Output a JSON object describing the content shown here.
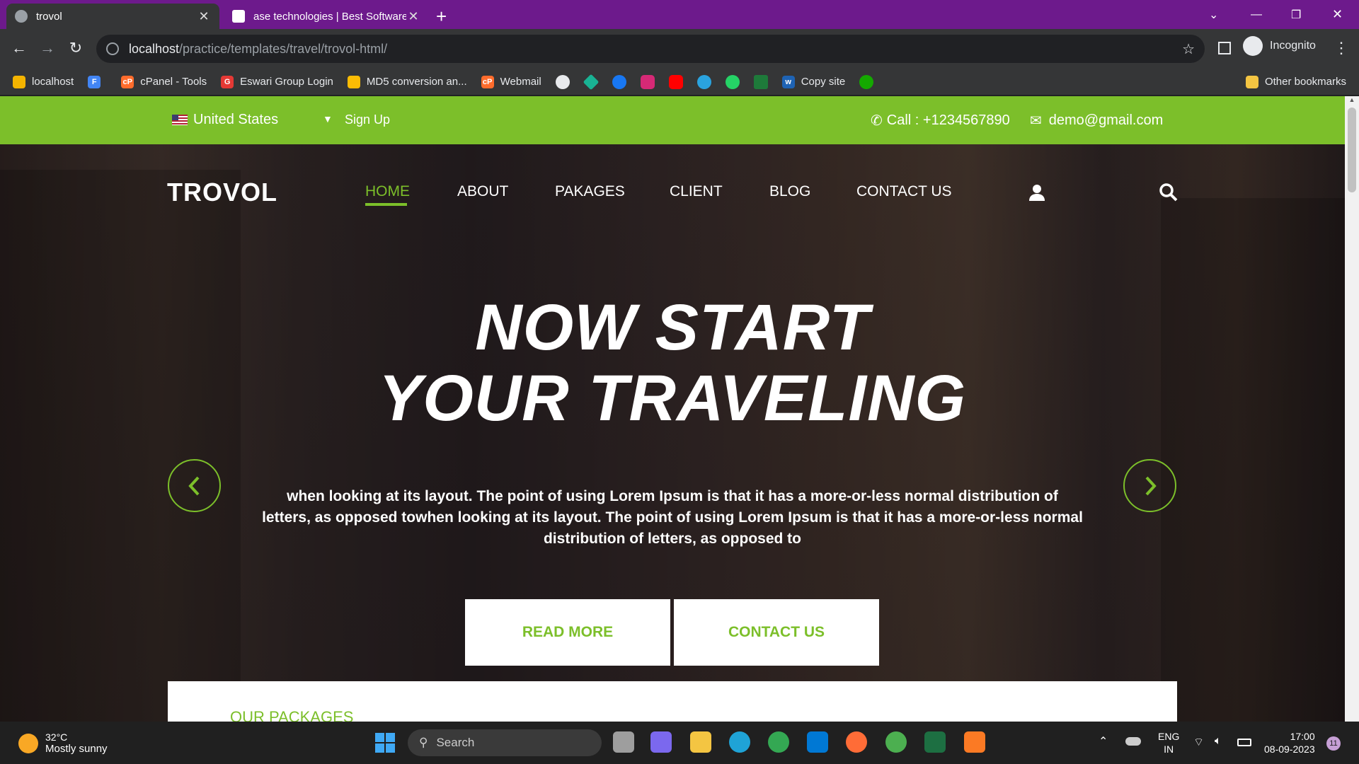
{
  "browser": {
    "tabs": [
      {
        "title": "trovol",
        "active": true
      },
      {
        "title": "ase technologies | Best Software",
        "active": false
      }
    ],
    "url_host": "localhost",
    "url_path": "/practice/templates/travel/trovol-html/",
    "profile_label": "Incognito",
    "bookmarks": [
      {
        "label": "localhost",
        "color": "#f4b400"
      },
      {
        "label": "",
        "color": "#4285f4"
      },
      {
        "label": "cPanel - Tools",
        "color": "#ff6c2c"
      },
      {
        "label": "Eswari Group Login",
        "color": "#e53935"
      },
      {
        "label": "MD5 conversion an...",
        "color": "#fbbc04"
      },
      {
        "label": "Webmail",
        "color": "#ff6c2c"
      }
    ],
    "bookmark_icons": [
      "github-icon",
      "diamond-icon",
      "facebook-icon",
      "instagram-icon",
      "youtube-icon",
      "telegram-icon",
      "whatsapp-icon",
      "chart-icon"
    ],
    "bookmark_extra": [
      {
        "label": "Copy site",
        "color": "#1e63b4"
      }
    ],
    "other_bookmarks": "Other bookmarks"
  },
  "site": {
    "topbar": {
      "country": "United States",
      "signup": "Sign Up",
      "call": "Call : +1234567890",
      "email": "demo@gmail.com"
    },
    "logo": "TROVOL",
    "nav": [
      "HOME",
      "ABOUT",
      "PAKAGES",
      "CLIENT",
      "BLOG",
      "CONTACT US"
    ],
    "hero": {
      "headline_1": "NOW START",
      "headline_2": "YOUR TRAVELING",
      "lead": "when looking at its layout. The point of using Lorem Ipsum is that it has a more-or-less normal distribution of letters, as opposed towhen looking at its layout. The point of using Lorem Ipsum is that it has a more-or-less normal distribution of letters, as opposed to",
      "btn_read_more": "READ MORE",
      "btn_contact": "CONTACT US"
    },
    "packages_title": "OUR PACKAGES",
    "accent_color": "#7cbf2a"
  },
  "taskbar": {
    "weather_temp": "32°C",
    "weather_desc": "Mostly sunny",
    "search_placeholder": "Search",
    "lang_1": "ENG",
    "lang_2": "IN",
    "time": "17:00",
    "date": "08-09-2023",
    "notif_count": "11"
  }
}
